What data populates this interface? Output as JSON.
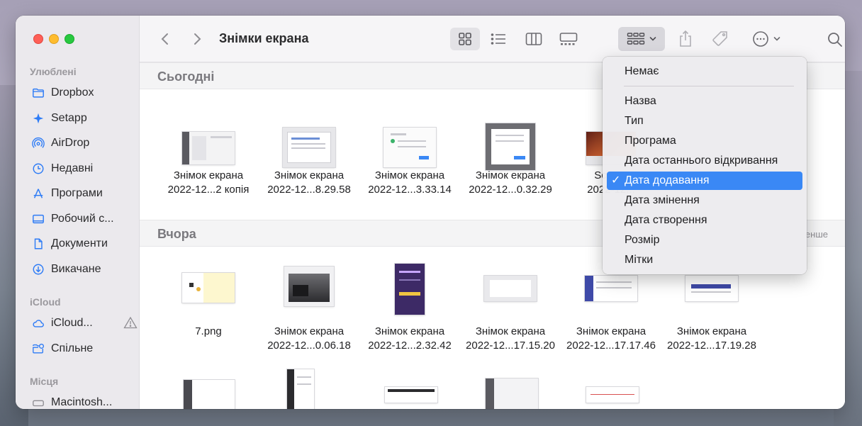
{
  "window": {
    "title": "Знімки екрана"
  },
  "sidebar": {
    "sections": [
      {
        "label": "Улюблені",
        "items": [
          {
            "label": "Dropbox",
            "icon": "folder-icon"
          },
          {
            "label": "Setapp",
            "icon": "setapp-icon"
          },
          {
            "label": "AirDrop",
            "icon": "airdrop-icon"
          },
          {
            "label": "Недавні",
            "icon": "clock-icon"
          },
          {
            "label": "Програми",
            "icon": "apps-icon"
          },
          {
            "label": "Робочий с...",
            "icon": "desktop-icon"
          },
          {
            "label": "Документи",
            "icon": "document-icon"
          },
          {
            "label": "Викачане",
            "icon": "download-icon"
          }
        ]
      },
      {
        "label": "iCloud",
        "items": [
          {
            "label": "iCloud...",
            "icon": "cloud-icon"
          },
          {
            "label": "Спільне",
            "icon": "shared-folder-icon"
          }
        ]
      },
      {
        "label": "Місця",
        "items": [
          {
            "label": "Macintosh...",
            "icon": "disk-icon"
          }
        ]
      }
    ]
  },
  "sections": [
    {
      "label": "Сьогодні",
      "items": [
        {
          "line1": "Знімок екрана",
          "line2": "2022-12...2 копія"
        },
        {
          "line1": "Знімок екрана",
          "line2": "2022-12...8.29.58"
        },
        {
          "line1": "Знімок екрана",
          "line2": "2022-12...3.33.14"
        },
        {
          "line1": "Знімок екрана",
          "line2": "2022-12...0.32.29"
        },
        {
          "line1": "Screen",
          "line2": "2022-12..."
        }
      ]
    },
    {
      "label": "Вчора",
      "more_label": "енше",
      "items": [
        {
          "line1": "7.png",
          "line2": ""
        },
        {
          "line1": "Знімок екрана",
          "line2": "2022-12...0.06.18"
        },
        {
          "line1": "Знімок екрана",
          "line2": "2022-12...2.32.42"
        },
        {
          "line1": "Знімок екрана",
          "line2": "2022-12...17.15.20"
        },
        {
          "line1": "Знімок екрана",
          "line2": "2022-12...17.17.46"
        },
        {
          "line1": "Знімок екрана",
          "line2": "2022-12...17.19.28"
        }
      ]
    }
  ],
  "group_menu": {
    "items": [
      {
        "label": "Немає"
      },
      {
        "label": "Назва"
      },
      {
        "label": "Тип"
      },
      {
        "label": "Програма"
      },
      {
        "label": "Дата останнього відкривання"
      },
      {
        "label": "Дата додавання",
        "check": "✓"
      },
      {
        "label": "Дата змінення"
      },
      {
        "label": "Дата створення"
      },
      {
        "label": "Розмір"
      },
      {
        "label": "Мітки"
      }
    ],
    "selected_index": 5
  },
  "colors": {
    "accent": "#3a88f5",
    "sidebar_icon": "#2e7cf6"
  }
}
